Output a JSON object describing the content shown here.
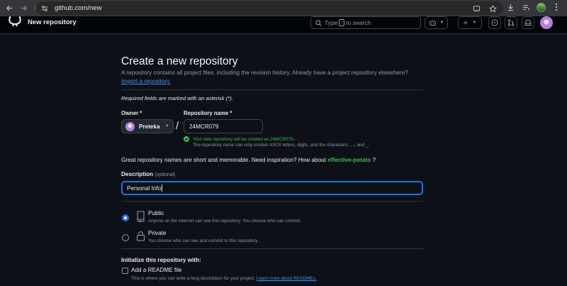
{
  "browser": {
    "url": "github.com/new"
  },
  "header": {
    "title": "New repository",
    "search_pre": "Type",
    "search_key": "/",
    "search_post": "to search"
  },
  "form": {
    "title": "Create a new repository",
    "subtitle": "A repository contains all project files, including the revision history. Already have a project repository elsewhere?",
    "import_link": "Import a repository.",
    "required_note": "Required fields are marked with an asterisk (*).",
    "owner_label": "Owner *",
    "owner_value": "Preteka",
    "repo_label": "Repository name *",
    "repo_value": "24MCR079",
    "slash": "/",
    "availability_msg": "Your new repository will be created as 24MCR079-.",
    "name_rule": "The repository name can only contain ASCII letters, digits, and the characters ., -, and _.",
    "inspiration_text": "Great repository names are short and memorable. Need inspiration? How about",
    "inspiration_name": "effective-potato",
    "inspiration_suffix": "?",
    "description_label": "Description",
    "description_optional": "(optional)",
    "description_value": "Personal Info"
  },
  "visibility": {
    "options": [
      {
        "label": "Public",
        "desc": "Anyone on the internet can see this repository. You choose who can commit.",
        "selected": true
      },
      {
        "label": "Private",
        "desc": "You choose who can see and commit to this repository.",
        "selected": false
      }
    ]
  },
  "initialize": {
    "title": "Initialize this repository with:",
    "readme_label": "Add a README file",
    "readme_desc": "This is where you can write a long description for your project.",
    "readme_link": "Learn more about READMEs."
  },
  "colors": {
    "background": "#0d1117",
    "accent": "#1f6feb",
    "success": "#3fb950",
    "link": "#4493f8"
  },
  "icons": [
    "back-arrow-icon",
    "forward-arrow-icon",
    "reload-icon",
    "tune-icon",
    "cast-icon",
    "star-icon",
    "download-icon",
    "reading-list-icon",
    "menu-dots-icon",
    "github-logo-icon",
    "search-icon",
    "copilot-icon",
    "plus-icon",
    "issues-icon",
    "pull-requests-icon",
    "inbox-icon",
    "repo-icon",
    "lock-icon",
    "check-icon"
  ]
}
